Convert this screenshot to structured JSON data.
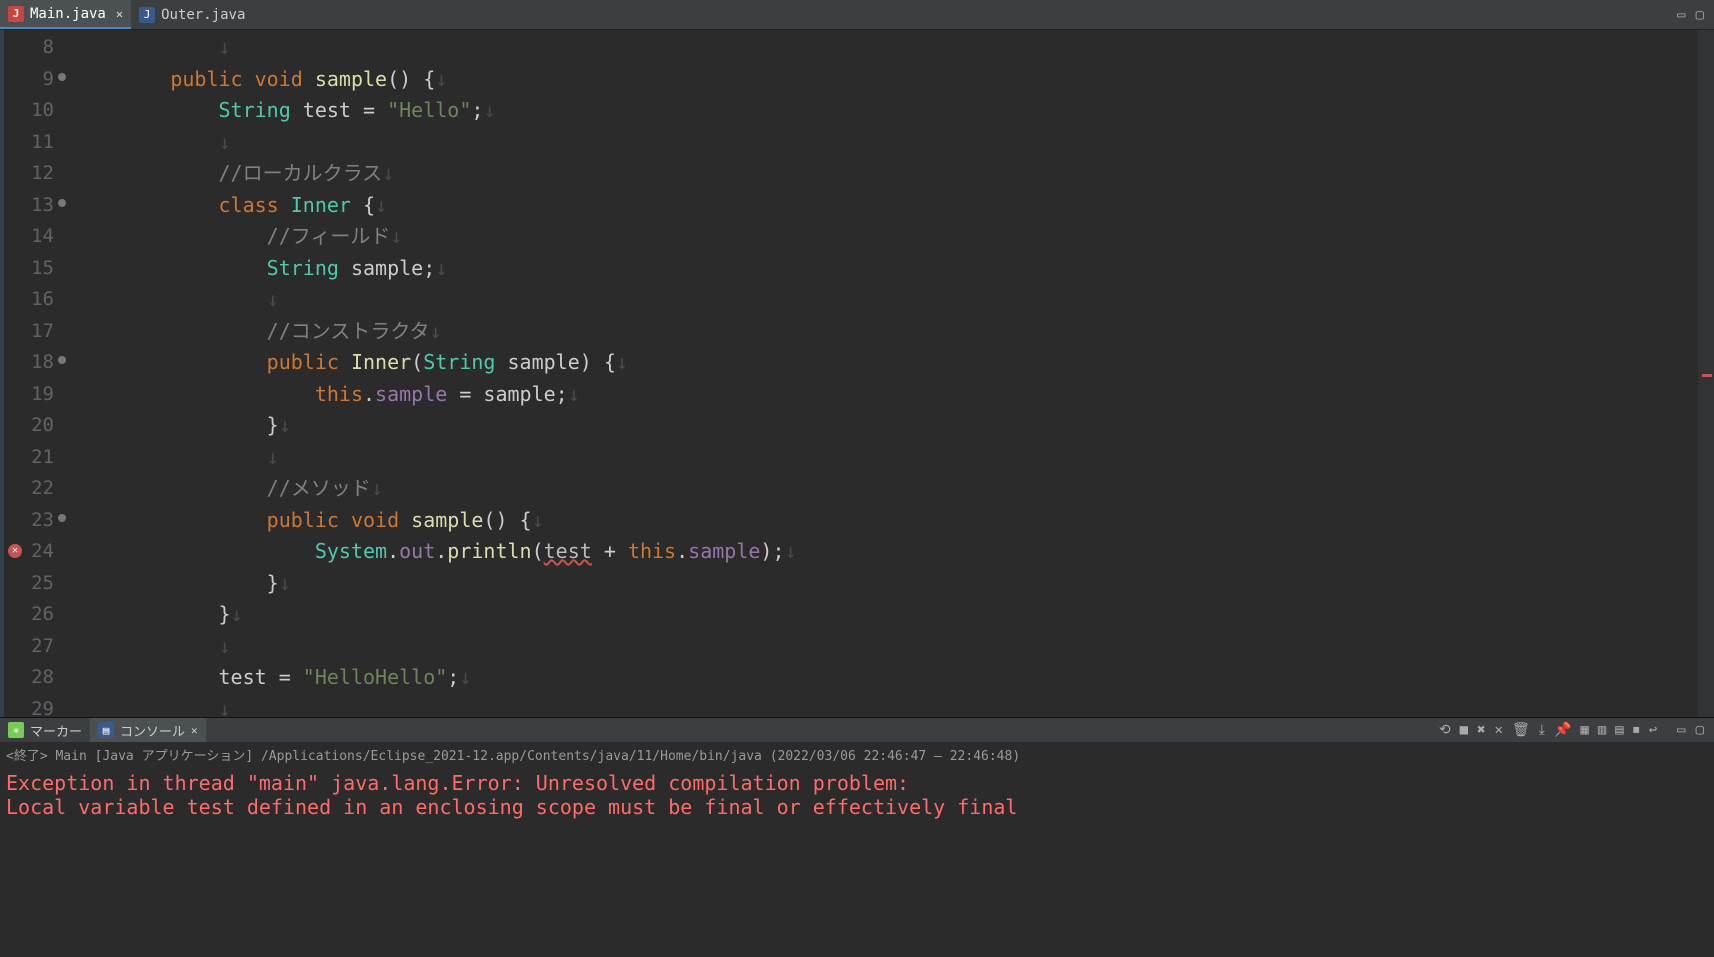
{
  "tabs": {
    "active": {
      "label": "Main.java",
      "icon": "java-error-icon"
    },
    "other": {
      "label": "Outer.java",
      "icon": "java-file-icon"
    }
  },
  "gutter_start": 8,
  "annotated": {
    "9": "method",
    "13": "class",
    "18": "method",
    "23": "method"
  },
  "error_line": 24,
  "code": [
    {
      "n": 8,
      "indent": 3,
      "segs": []
    },
    {
      "n": 9,
      "indent": 2,
      "segs": [
        [
          "kw",
          "public"
        ],
        [
          "op",
          " "
        ],
        [
          "kw",
          "void"
        ],
        [
          "op",
          " "
        ],
        [
          "name",
          "sample"
        ],
        [
          "op",
          "() {"
        ]
      ]
    },
    {
      "n": 10,
      "indent": 3,
      "segs": [
        [
          "type",
          "String"
        ],
        [
          "op",
          " "
        ],
        [
          "op",
          "test = "
        ],
        [
          "str",
          "\"Hello\""
        ],
        [
          "op",
          ";"
        ]
      ]
    },
    {
      "n": 11,
      "indent": 3,
      "segs": []
    },
    {
      "n": 12,
      "indent": 3,
      "segs": [
        [
          "cmt",
          "//ローカルクラス"
        ]
      ]
    },
    {
      "n": 13,
      "indent": 3,
      "segs": [
        [
          "kw",
          "class"
        ],
        [
          "op",
          " "
        ],
        [
          "type",
          "Inner"
        ],
        [
          "op",
          " {"
        ]
      ]
    },
    {
      "n": 14,
      "indent": 4,
      "segs": [
        [
          "cmt",
          "//フィールド"
        ]
      ]
    },
    {
      "n": 15,
      "indent": 4,
      "segs": [
        [
          "type",
          "String"
        ],
        [
          "op",
          " "
        ],
        [
          "op",
          "sample;"
        ]
      ]
    },
    {
      "n": 16,
      "indent": 4,
      "segs": []
    },
    {
      "n": 17,
      "indent": 4,
      "segs": [
        [
          "cmt",
          "//コンストラクタ"
        ]
      ]
    },
    {
      "n": 18,
      "indent": 4,
      "segs": [
        [
          "kw",
          "public"
        ],
        [
          "op",
          " "
        ],
        [
          "name",
          "Inner"
        ],
        [
          "op",
          "("
        ],
        [
          "type",
          "String"
        ],
        [
          "op",
          " sample) {"
        ]
      ]
    },
    {
      "n": 19,
      "indent": 5,
      "segs": [
        [
          "kw",
          "this"
        ],
        [
          "op",
          "."
        ],
        [
          "field",
          "sample"
        ],
        [
          "op",
          " = sample;"
        ]
      ]
    },
    {
      "n": 20,
      "indent": 4,
      "segs": [
        [
          "op",
          "}"
        ]
      ]
    },
    {
      "n": 21,
      "indent": 4,
      "segs": []
    },
    {
      "n": 22,
      "indent": 4,
      "segs": [
        [
          "cmt",
          "//メソッド"
        ]
      ]
    },
    {
      "n": 23,
      "indent": 4,
      "segs": [
        [
          "kw",
          "public"
        ],
        [
          "op",
          " "
        ],
        [
          "kw",
          "void"
        ],
        [
          "op",
          " "
        ],
        [
          "name",
          "sample"
        ],
        [
          "op",
          "() {"
        ]
      ]
    },
    {
      "n": 24,
      "indent": 5,
      "segs": [
        [
          "sys",
          "System"
        ],
        [
          "op",
          "."
        ],
        [
          "field",
          "out"
        ],
        [
          "op",
          "."
        ],
        [
          "name",
          "println"
        ],
        [
          "op",
          "("
        ],
        [
          "err",
          "test"
        ],
        [
          "op",
          " + "
        ],
        [
          "kw",
          "this"
        ],
        [
          "op",
          "."
        ],
        [
          "field",
          "sample"
        ],
        [
          "op",
          ");"
        ]
      ]
    },
    {
      "n": 25,
      "indent": 4,
      "segs": [
        [
          "op",
          "}"
        ]
      ]
    },
    {
      "n": 26,
      "indent": 3,
      "segs": [
        [
          "op",
          "}"
        ]
      ]
    },
    {
      "n": 27,
      "indent": 3,
      "segs": []
    },
    {
      "n": 28,
      "indent": 3,
      "segs": [
        [
          "op",
          "test = "
        ],
        [
          "str",
          "\"HelloHello\""
        ],
        [
          "op",
          ";"
        ]
      ]
    },
    {
      "n": 29,
      "indent": 3,
      "segs": []
    }
  ],
  "bottom": {
    "tab_marker": "マーカー",
    "tab_console": "コンソール",
    "info": "<終了> Main [Java アプリケーション] /Applications/Eclipse_2021-12.app/Contents/java/11/Home/bin/java  (2022/03/06 22:46:47 – 22:46:48)",
    "exception_line1": "Exception in thread \"main\" java.lang.Error: Unresolved compilation problem: ",
    "exception_line2": "    Local variable test defined in an enclosing scope must be final or effectively final"
  },
  "toolbar_icons": [
    "link-icon",
    "stop-icon",
    "remove-all-icon",
    "remove-icon",
    "clear-console-icon",
    "scroll-lock-icon",
    "pin-icon",
    "display-selected-icon",
    "open-console-icon",
    "new-console-icon",
    "terminate-icon",
    "wrap-icon"
  ]
}
